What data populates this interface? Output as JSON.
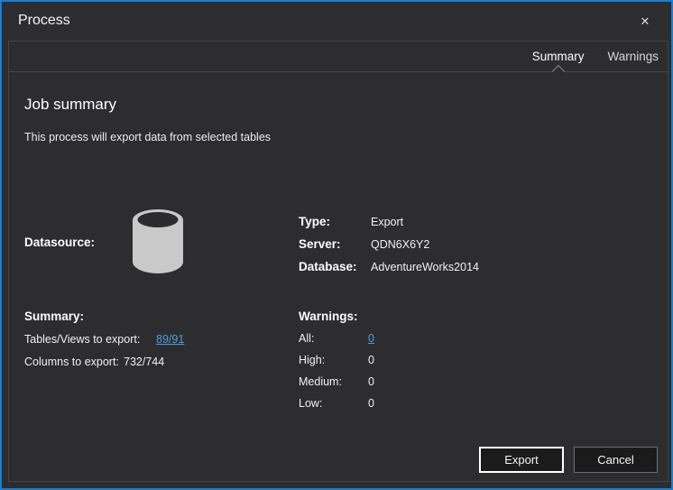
{
  "window": {
    "title": "Process",
    "close_icon": "✕"
  },
  "tabs": [
    {
      "label": "Summary",
      "active": true
    },
    {
      "label": "Warnings",
      "active": false
    }
  ],
  "job": {
    "heading": "Job summary",
    "description": "This process will export data from selected tables"
  },
  "datasource": {
    "label": "Datasource:",
    "icon": "database-cylinder-icon",
    "details": [
      {
        "label": "Type:",
        "value": "Export"
      },
      {
        "label": "Server:",
        "value": "QDN6X6Y2"
      },
      {
        "label": "Database:",
        "value": "AdventureWorks2014"
      }
    ]
  },
  "summary": {
    "label": "Summary:",
    "rows": [
      {
        "label": "Tables/Views to export:",
        "value": "89/91",
        "link": true
      },
      {
        "label": "Columns to export:",
        "value": "732/744",
        "link": false
      }
    ]
  },
  "warnings": {
    "label": "Warnings:",
    "rows": [
      {
        "label": "All:",
        "value": "0",
        "link": true
      },
      {
        "label": "High:",
        "value": "0",
        "link": false
      },
      {
        "label": "Medium:",
        "value": "0",
        "link": false
      },
      {
        "label": "Low:",
        "value": "0",
        "link": false
      }
    ]
  },
  "buttons": {
    "export": "Export",
    "cancel": "Cancel"
  },
  "colors": {
    "accent_border": "#1580d2",
    "background": "#2d2d30",
    "frame_border": "#464649",
    "link": "#4ba0e4",
    "text": "#f1f1f1",
    "icon_gray": "#c9c9c9"
  }
}
